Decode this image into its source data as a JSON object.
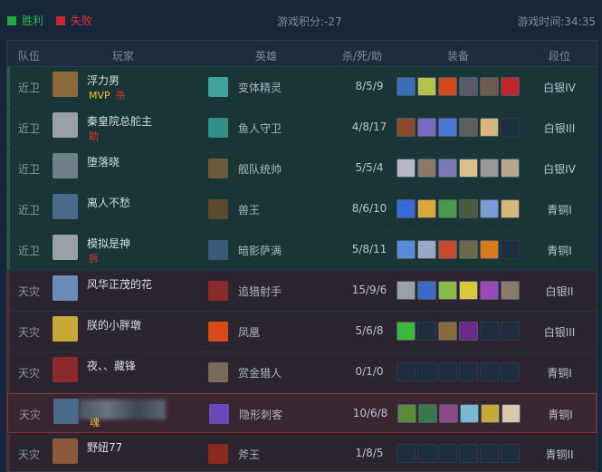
{
  "header": {
    "win_label": "胜利",
    "lose_label": "失败",
    "score": "游戏积分:-27",
    "time": "游戏时间:34:35"
  },
  "columns": [
    "队伍",
    "玩家",
    "英雄",
    "杀/死/助",
    "装备",
    "段位"
  ],
  "rows": [
    {
      "team": "近卫",
      "player": "浮力男",
      "tags": [
        "MVP",
        "杀"
      ],
      "hero": "变体精灵",
      "kda": "8/5/9",
      "rank": "白银IV",
      "style": "green",
      "avatar_color": "#8a6a3a",
      "hero_color": "#3fa29c",
      "items": [
        "#3a6fb8",
        "#b6c24a",
        "#d24a1c",
        "#5a5a6e",
        "#6d5c4c",
        "#c1262a"
      ]
    },
    {
      "team": "近卫",
      "player": "秦皇院总舵主",
      "tags": [
        "助"
      ],
      "hero": "鱼人守卫",
      "kda": "4/8/17",
      "rank": "白银III",
      "style": "green",
      "avatar_color": "#9aa0a6",
      "hero_color": "#2f8f8a",
      "items": [
        "#8a4a2a",
        "#7a6ac0",
        "#4a7ad8",
        "#5e5e5e",
        "#d8b87a",
        "empty"
      ]
    },
    {
      "team": "近卫",
      "player": "堕落晓",
      "tags": [],
      "hero": "舰队统帅",
      "kda": "5/5/4",
      "rank": "白银IV",
      "style": "green",
      "avatar_color": "#6f7f86",
      "hero_color": "#6b5a3a",
      "items": [
        "#b8b8c8",
        "#8a7a6a",
        "#7a7ab8",
        "#d8c08a",
        "#9a9a9a",
        "#b8a88a"
      ]
    },
    {
      "team": "近卫",
      "player": "离人不愁",
      "tags": [],
      "hero": "兽王",
      "kda": "8/6/10",
      "rank": "青铜I",
      "style": "green",
      "avatar_color": "#4a6a8a",
      "hero_color": "#5a4a2a",
      "items": [
        "#3a6ad8",
        "#d8a83a",
        "#4a9a4a",
        "#4a5a3a",
        "#7a9ad8",
        "#d8b87a"
      ]
    },
    {
      "team": "近卫",
      "player": "模拟是神",
      "tags": [
        "拆"
      ],
      "hero": "暗影萨满",
      "kda": "5/8/11",
      "rank": "青铜I",
      "style": "green",
      "avatar_color": "#9aa0a6",
      "hero_color": "#3a5a7a",
      "items": [
        "#5a8ad8",
        "#9aa8c8",
        "#c84a2a",
        "#6a6a4a",
        "#d8781a",
        "empty"
      ]
    },
    {
      "team": "天灾",
      "player": "风华正茂的花",
      "tags": [],
      "hero": "追猎射手",
      "kda": "15/9/6",
      "rank": "白银II",
      "style": "red",
      "avatar_color": "#6a8ab8",
      "hero_color": "#8a2a2a",
      "items": [
        "#9aa0a8",
        "#3a6ac8",
        "#8ab84a",
        "#d8c83a",
        "#9a4ab8",
        "#8a7a6a"
      ]
    },
    {
      "team": "天灾",
      "player": "朕的小胖墩",
      "tags": [],
      "hero": "凤凰",
      "kda": "5/6/8",
      "rank": "白银III",
      "style": "red",
      "avatar_color": "#c8a838",
      "hero_color": "#d84a1a",
      "items": [
        "#3ab83a",
        "empty",
        "#8a6a3a",
        "#6a2a8a",
        "empty",
        "empty"
      ]
    },
    {
      "team": "天灾",
      "player": "夜、、藏锋",
      "tags": [],
      "hero": "赏金猎人",
      "kda": "0/1/0",
      "rank": "青铜I",
      "style": "red",
      "avatar_color": "#8a2a2a",
      "hero_color": "#7a6a5a",
      "items": [
        "empty",
        "empty",
        "empty",
        "empty",
        "empty",
        "empty"
      ]
    },
    {
      "team": "天灾",
      "player": "",
      "tags": [
        "魂"
      ],
      "hero": "隐形刺客",
      "kda": "10/6/8",
      "rank": "青铜I",
      "style": "hl",
      "avatar_color": "#4a6a8a",
      "hero_color": "#6a4ab8",
      "items": [
        "#5a8a3a",
        "#3a7a4a",
        "#8a4a8a",
        "#7ab8d8",
        "#c8a83a",
        "#d8c8a8"
      ]
    },
    {
      "team": "天灾",
      "player": "野妞77",
      "tags": [],
      "hero": "斧王",
      "kda": "1/8/5",
      "rank": "青铜II",
      "style": "red",
      "avatar_color": "#8a5a3a",
      "hero_color": "#8a2a1a",
      "items": [
        "empty",
        "empty",
        "empty",
        "empty",
        "empty",
        "empty"
      ]
    }
  ]
}
